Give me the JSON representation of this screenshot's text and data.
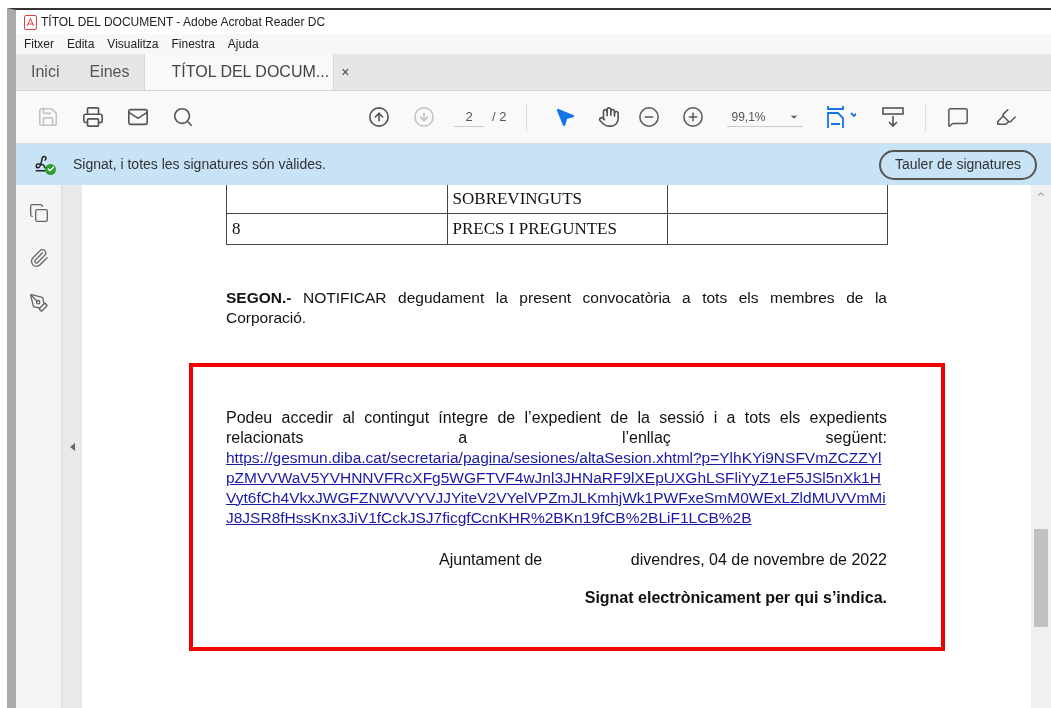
{
  "window": {
    "title": "TÍTOL DEL DOCUMENT - Adobe Acrobat Reader DC"
  },
  "menu": [
    "Fitxer",
    "Edita",
    "Visualitza",
    "Finestra",
    "Ajuda"
  ],
  "tabs": [
    {
      "label": "Inici",
      "selected": false
    },
    {
      "label": "Eines",
      "selected": false
    },
    {
      "label": "TÍTOL DEL DOCUM...",
      "selected": true,
      "close": "×"
    }
  ],
  "toolbar": {
    "file_tools": [
      {
        "kind": "save",
        "disabled": true
      },
      {
        "kind": "print",
        "disabled": false
      },
      {
        "kind": "mail",
        "disabled": false
      },
      {
        "kind": "search",
        "disabled": false
      }
    ],
    "page_tools": [
      {
        "kind": "prev",
        "disabled": false
      },
      {
        "kind": "next",
        "disabled": true
      }
    ],
    "page_current": "2",
    "page_total": "/ 2",
    "pointer_tools": [
      {
        "kind": "select",
        "selected": true
      },
      {
        "kind": "hand",
        "selected": false
      }
    ],
    "zoom": "99,1%"
  },
  "signature_bar": {
    "message": "Signat, i totes les signatures són vàlides.",
    "button": "Tauler de signatures"
  },
  "document": {
    "table_rows": [
      [
        "",
        "SOBREVINGUTS",
        ""
      ],
      [
        "8",
        "PRECS I PREGUNTES",
        ""
      ]
    ],
    "paragraph": "**SEGON.-** NOTIFICAR  degudament la present convocatòria a tots els membres de la Corporació.",
    "box": {
      "text": "Podeu accedir al contingut íntegre de l’expedient de la sessió i a tots els expedients relacionats a l’enllaç següent:",
      "link": "https://gesmun.diba.cat/secretaria/pagina/sesiones/altaSesion.xhtml?p=YlhKYi9NSFVmZCZZYlpZMVVWaV5YVHNNVFRcXFg5WGFTVF4wJnl3JHNaRF9lXEpUXGhLSFliYyZ1eF5JSl5nXk1HVyt6fCh4VkxJWGFZNWVVYVJJYiteV2VYelVPZmJLKmhjWk1PWFxeSmM0WExLZldMUVVmMiJ8JSR8fHssKnx3JiV1fCckJSJ7ficgfCcnKHR%2BKn19fCB%2BLiF1LCB%2B",
      "place": "Ajuntament de",
      "date": "divendres, 04 de novembre de 2022",
      "signature": "Signat electrònicament per qui s’indica."
    }
  }
}
